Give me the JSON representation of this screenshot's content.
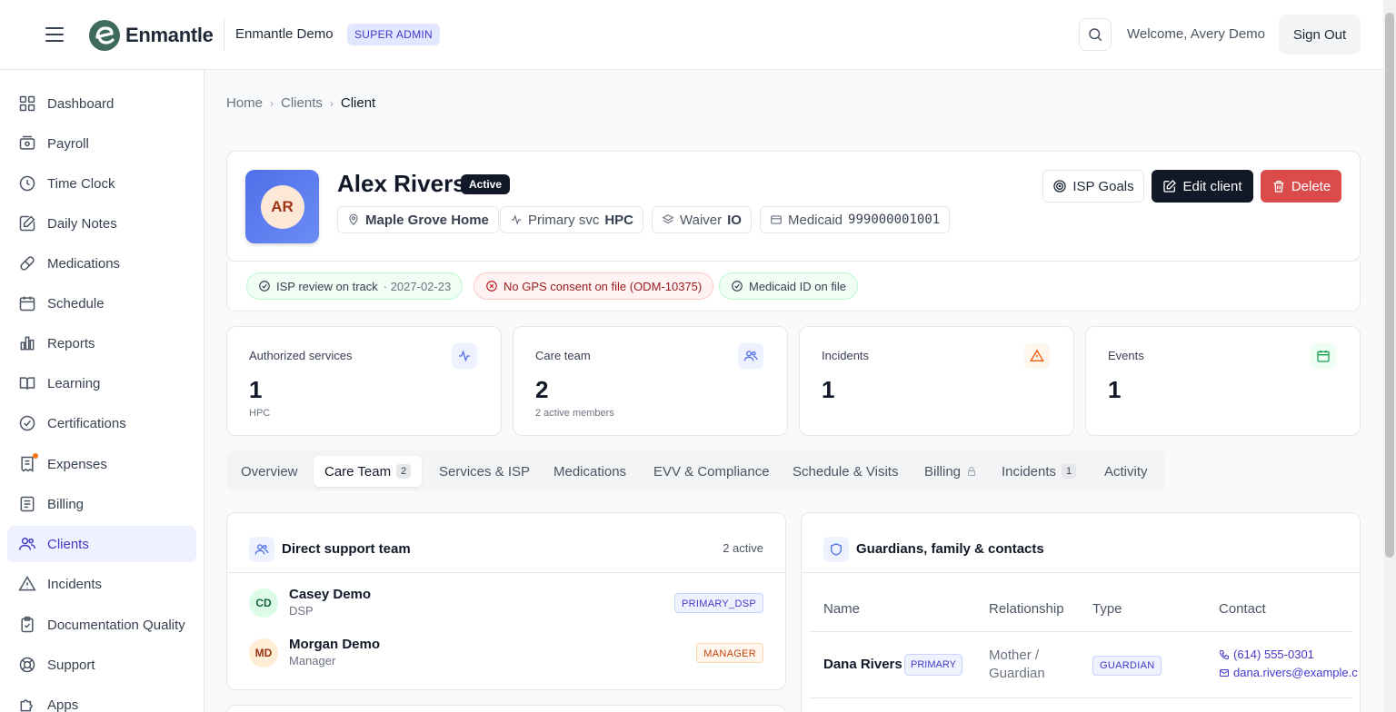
{
  "header": {
    "brand": "Enmantle",
    "org_name": "Enmantle Demo",
    "role_badge": "SUPER ADMIN",
    "welcome": "Welcome, Avery Demo",
    "sign_out": "Sign Out"
  },
  "sidebar": {
    "items": [
      {
        "label": "Dashboard",
        "icon": "grid-icon"
      },
      {
        "label": "Payroll",
        "icon": "wallet-icon"
      },
      {
        "label": "Time Clock",
        "icon": "clock-icon"
      },
      {
        "label": "Daily Notes",
        "icon": "note-edit-icon"
      },
      {
        "label": "Medications",
        "icon": "pill-icon"
      },
      {
        "label": "Schedule",
        "icon": "calendar-icon"
      },
      {
        "label": "Reports",
        "icon": "bar-chart-icon"
      },
      {
        "label": "Learning",
        "icon": "book-icon"
      },
      {
        "label": "Certifications",
        "icon": "badge-check-icon"
      },
      {
        "label": "Expenses",
        "icon": "receipt-icon"
      },
      {
        "label": "Billing",
        "icon": "document-lines-icon"
      },
      {
        "label": "Clients",
        "icon": "users-icon"
      },
      {
        "label": "Incidents",
        "icon": "warning-icon"
      },
      {
        "label": "Documentation Quality",
        "icon": "clipboard-check-icon"
      },
      {
        "label": "Support",
        "icon": "lifebuoy-icon"
      },
      {
        "label": "Apps",
        "icon": "puzzle-icon"
      }
    ],
    "active": "Clients"
  },
  "breadcrumb": [
    "Home",
    "Clients",
    "Client"
  ],
  "client": {
    "initials": "AR",
    "name": "Alex Rivers",
    "status": "Active",
    "location": "Maple Grove Home",
    "primary_svc_label": "Primary svc",
    "primary_svc": "HPC",
    "waiver_label": "Waiver",
    "waiver": "IO",
    "medicaid_label": "Medicaid",
    "medicaid": "999000001001"
  },
  "actions": {
    "isp_goals": "ISP Goals",
    "edit": "Edit client",
    "delete": "Delete"
  },
  "alerts": [
    {
      "text": "ISP review on track",
      "extra": "· 2027-02-23",
      "kind": "ok"
    },
    {
      "text": "No GPS consent on file (ODM-10375)",
      "extra": "",
      "kind": "bad"
    },
    {
      "text": "Medicaid ID on file",
      "extra": "",
      "kind": "ok"
    }
  ],
  "stats": [
    {
      "label": "Authorized services",
      "value": "1",
      "sub": "HPC",
      "icon": "activity-icon",
      "color": "#4f6fe8"
    },
    {
      "label": "Care team",
      "value": "2",
      "sub": "2 active members",
      "icon": "users-icon",
      "color": "#4f6fe8"
    },
    {
      "label": "Incidents",
      "value": "1",
      "sub": "",
      "icon": "warning-icon",
      "color": "#ea580c"
    },
    {
      "label": "Events",
      "value": "1",
      "sub": "",
      "icon": "calendar-icon",
      "color": "#16a34a"
    }
  ],
  "tabs": [
    {
      "label": "Overview",
      "count": ""
    },
    {
      "label": "Care Team",
      "count": "2"
    },
    {
      "label": "Services & ISP",
      "count": ""
    },
    {
      "label": "Medications",
      "count": ""
    },
    {
      "label": "EVV & Compliance",
      "count": ""
    },
    {
      "label": "Schedule & Visits",
      "count": ""
    },
    {
      "label": "Billing",
      "count": ""
    },
    {
      "label": "Incidents",
      "count": "1"
    },
    {
      "label": "Activity",
      "count": ""
    }
  ],
  "support_team": {
    "title": "Direct support team",
    "count": "2 active",
    "members": [
      {
        "initials": "CD",
        "name": "Casey Demo",
        "role": "DSP",
        "tag": "PRIMARY_DSP"
      },
      {
        "initials": "MD",
        "name": "Morgan Demo",
        "role": "Manager",
        "tag": "MANAGER"
      }
    ]
  },
  "contacts": {
    "title": "Guardians, family & contacts",
    "columns": [
      "Name",
      "Relationship",
      "Type",
      "Contact"
    ],
    "rows": [
      {
        "name": "Dana Rivers",
        "primary": "PRIMARY",
        "relationship_1": "Mother /",
        "relationship_2": "Guardian",
        "type": "GUARDIAN",
        "phone": "(614) 555-0301",
        "email": "dana.rivers@example.c"
      }
    ]
  },
  "colors": {
    "accent": "#4338ca",
    "danger": "#dc4b4b",
    "dark": "#111827"
  }
}
